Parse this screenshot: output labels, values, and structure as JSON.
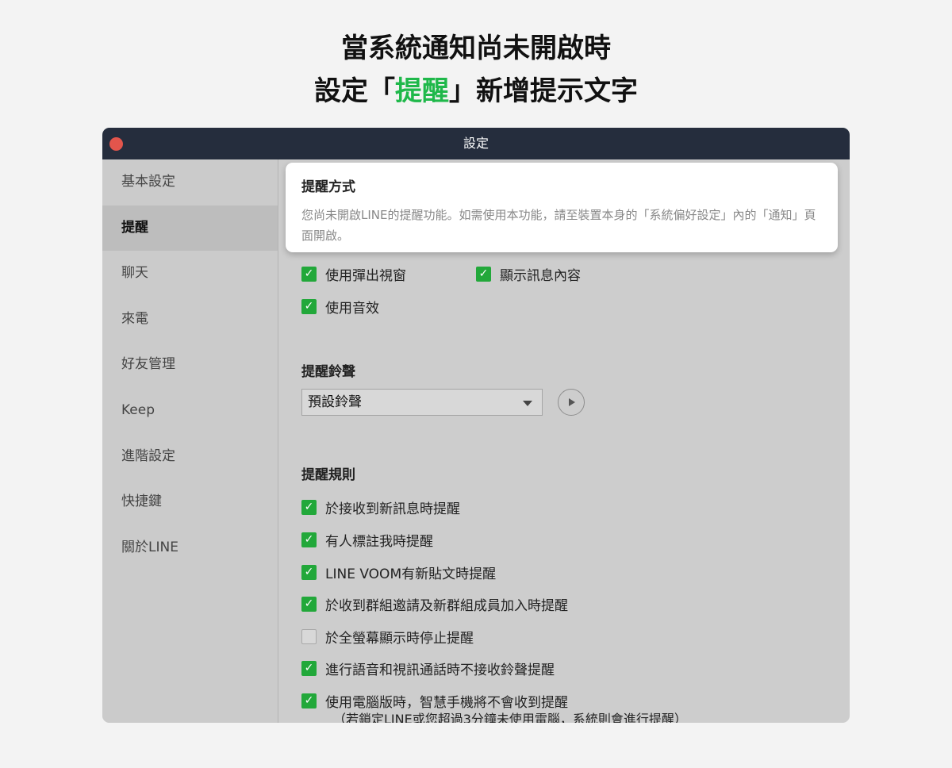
{
  "headline": {
    "line1": "當系統通知尚未開啟時",
    "line2_prefix": "設定「",
    "line2_highlight": "提醒",
    "line2_suffix": "」新增提示文字",
    "highlight_color": "#1fb84a"
  },
  "window": {
    "title": "設定",
    "close_icon": "close-dot-red"
  },
  "sidebar": {
    "items": [
      {
        "label": "基本設定",
        "active": false
      },
      {
        "label": "提醒",
        "active": true
      },
      {
        "label": "聊天",
        "active": false
      },
      {
        "label": "來電",
        "active": false
      },
      {
        "label": "好友管理",
        "active": false
      },
      {
        "label": "Keep",
        "active": false
      },
      {
        "label": "進階設定",
        "active": false
      },
      {
        "label": "快捷鍵",
        "active": false
      },
      {
        "label": "關於LINE",
        "active": false
      }
    ]
  },
  "tooltip": {
    "title": "提醒方式",
    "body": "您尚未開啟LINE的提醒功能。如需使用本功能，請至裝置本身的「系統偏好設定」內的「通知」頁面開啟。"
  },
  "method": {
    "options": [
      {
        "label": "使用彈出視窗",
        "checked": true
      },
      {
        "label": "顯示訊息內容",
        "checked": true
      },
      {
        "label": "使用音效",
        "checked": true
      }
    ]
  },
  "ringtone": {
    "title": "提醒鈴聲",
    "selected": "預設鈴聲",
    "play_icon": "play-icon"
  },
  "rules": {
    "title": "提醒規則",
    "items": [
      {
        "label": "於接收到新訊息時提醒",
        "checked": true
      },
      {
        "label": "有人標註我時提醒",
        "checked": true
      },
      {
        "label": "LINE VOOM有新貼文時提醒",
        "checked": true
      },
      {
        "label": "於收到群組邀請及新群組成員加入時提醒",
        "checked": true
      },
      {
        "label": "於全螢幕顯示時停止提醒",
        "checked": false
      },
      {
        "label": "進行語音和視訊通話時不接收鈴聲提醒",
        "checked": true
      },
      {
        "label": "使用電腦版時，智慧手機將不會收到提醒",
        "checked": true
      }
    ],
    "note": "（若鎖定LINE或您超過3分鐘未使用電腦，系統則會進行提醒）"
  },
  "colors": {
    "checkbox_checked": "#22a83a",
    "titlebar": "#252d3d",
    "close_dot": "#e2554c"
  }
}
